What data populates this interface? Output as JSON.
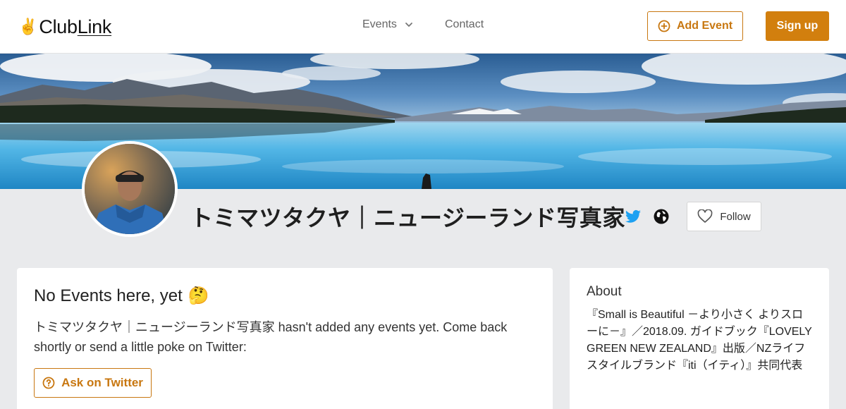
{
  "header": {
    "logo_text_a": "Club",
    "logo_text_b": "Link",
    "nav_events": "Events",
    "nav_contact": "Contact",
    "add_event_label": "Add Event",
    "sign_up_label": "Sign up"
  },
  "profile": {
    "name": "トミマツタクヤ｜ニュージーランド写真家",
    "follow_label": "Follow"
  },
  "events": {
    "title": "No Events here, yet",
    "emoji": "🤔",
    "message": "トミマツタクヤ｜ニュージーランド写真家 hasn't added any events yet. Come back shortly or send a little poke on Twitter:",
    "ask_label": "Ask on Twitter"
  },
  "about": {
    "title": "About",
    "text": "『Small is Beautiful －より小さく よりスローに－』／2018.09. ガイドブック『LOVELY GREEN NEW ZEALAND』出版／NZライフスタイルブランド『iti（イティ）』共同代表"
  },
  "colors": {
    "accent": "#d27f0e",
    "accent_outline": "#c87710",
    "twitter": "#1da1f2",
    "background": "#e9eaec"
  },
  "icons": [
    "victory-hand-icon",
    "chevron-down-icon",
    "plus-circle-icon",
    "twitter-icon",
    "globe-icon",
    "heart-icon",
    "help-circle-icon"
  ]
}
